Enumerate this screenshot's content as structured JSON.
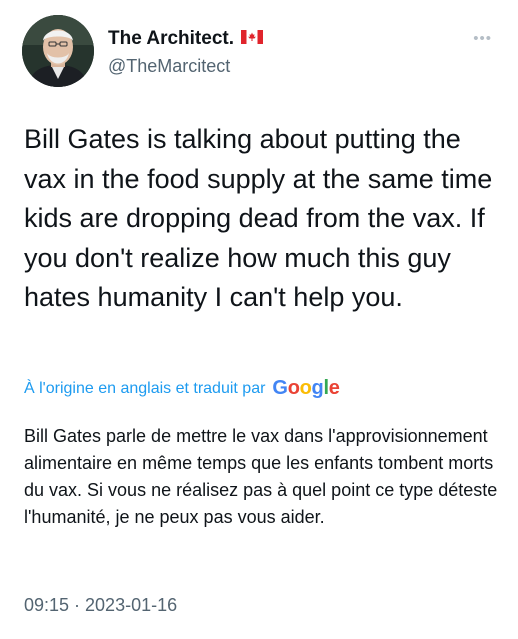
{
  "author": {
    "display_name": "The Architect.",
    "flag": "canada-flag-icon",
    "handle": "@TheMarcitect"
  },
  "tweet": {
    "text": "Bill Gates is talking about putting the vax in the food supply at the same time kids are dropping dead from the vax. If you don't realize how much this guy hates humanity I can't help you."
  },
  "translation": {
    "label": "À l'origine en anglais et traduit par",
    "provider": "Google",
    "text": "Bill Gates parle de mettre le vax dans l'approvisionnement alimentaire en même temps que les enfants tombent morts du vax. Si vous ne réalisez pas à quel point ce type déteste l'humanité, je ne peux pas vous aider."
  },
  "meta": {
    "timestamp": "09:15 · 2023-01-16"
  },
  "colors": {
    "link": "#1d9bf0",
    "secondary": "#536471",
    "text": "#0f1419"
  },
  "icons": {
    "more": "more-horizontal-icon"
  }
}
